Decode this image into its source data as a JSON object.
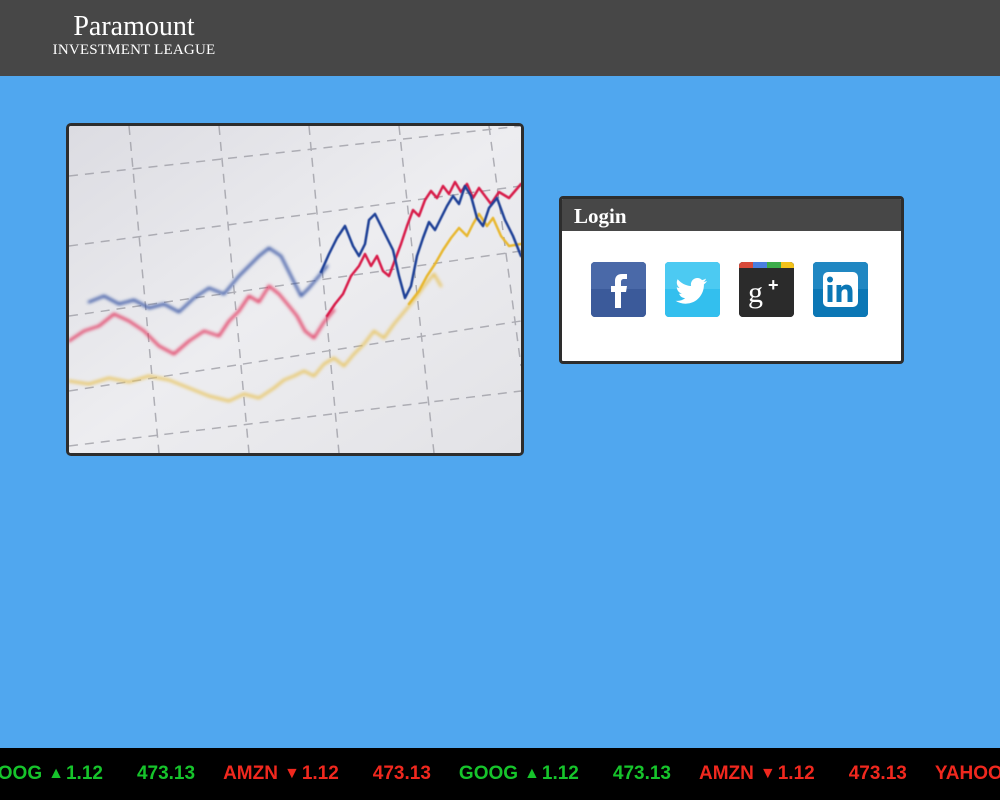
{
  "header": {
    "brand_name": "Paramount",
    "brand_subtitle": "INVESTMENT LEAGUE"
  },
  "login": {
    "title": "Login",
    "providers": [
      {
        "name": "facebook",
        "icon": "facebook-icon",
        "color": "#3b5a9a"
      },
      {
        "name": "twitter",
        "icon": "twitter-icon",
        "color": "#33bfee"
      },
      {
        "name": "google-plus",
        "icon": "google-plus-icon",
        "color": "#2b2b2b"
      },
      {
        "name": "linkedin",
        "icon": "linkedin-icon",
        "color": "#0b77b5"
      }
    ]
  },
  "ticker": {
    "up_color": "#16c42b",
    "down_color": "#f0281e",
    "items": [
      {
        "symbol": "GOOG",
        "direction": "up",
        "arrow": "▲",
        "change": "1.12",
        "price": "473.13"
      },
      {
        "symbol": "AMZN",
        "direction": "down",
        "arrow": "▼",
        "change": "1.12",
        "price": "473.13"
      },
      {
        "symbol": "GOOG",
        "direction": "up",
        "arrow": "▲",
        "change": "1.12",
        "price": "473.13"
      },
      {
        "symbol": "AMZN",
        "direction": "down",
        "arrow": "▼",
        "change": "1.12",
        "price": "473.13"
      },
      {
        "symbol": "YAHOO",
        "direction": "down",
        "arrow": "",
        "change": "",
        "price": ""
      }
    ]
  },
  "colors": {
    "page_background": "#50a7ef",
    "header_background": "#474747"
  }
}
